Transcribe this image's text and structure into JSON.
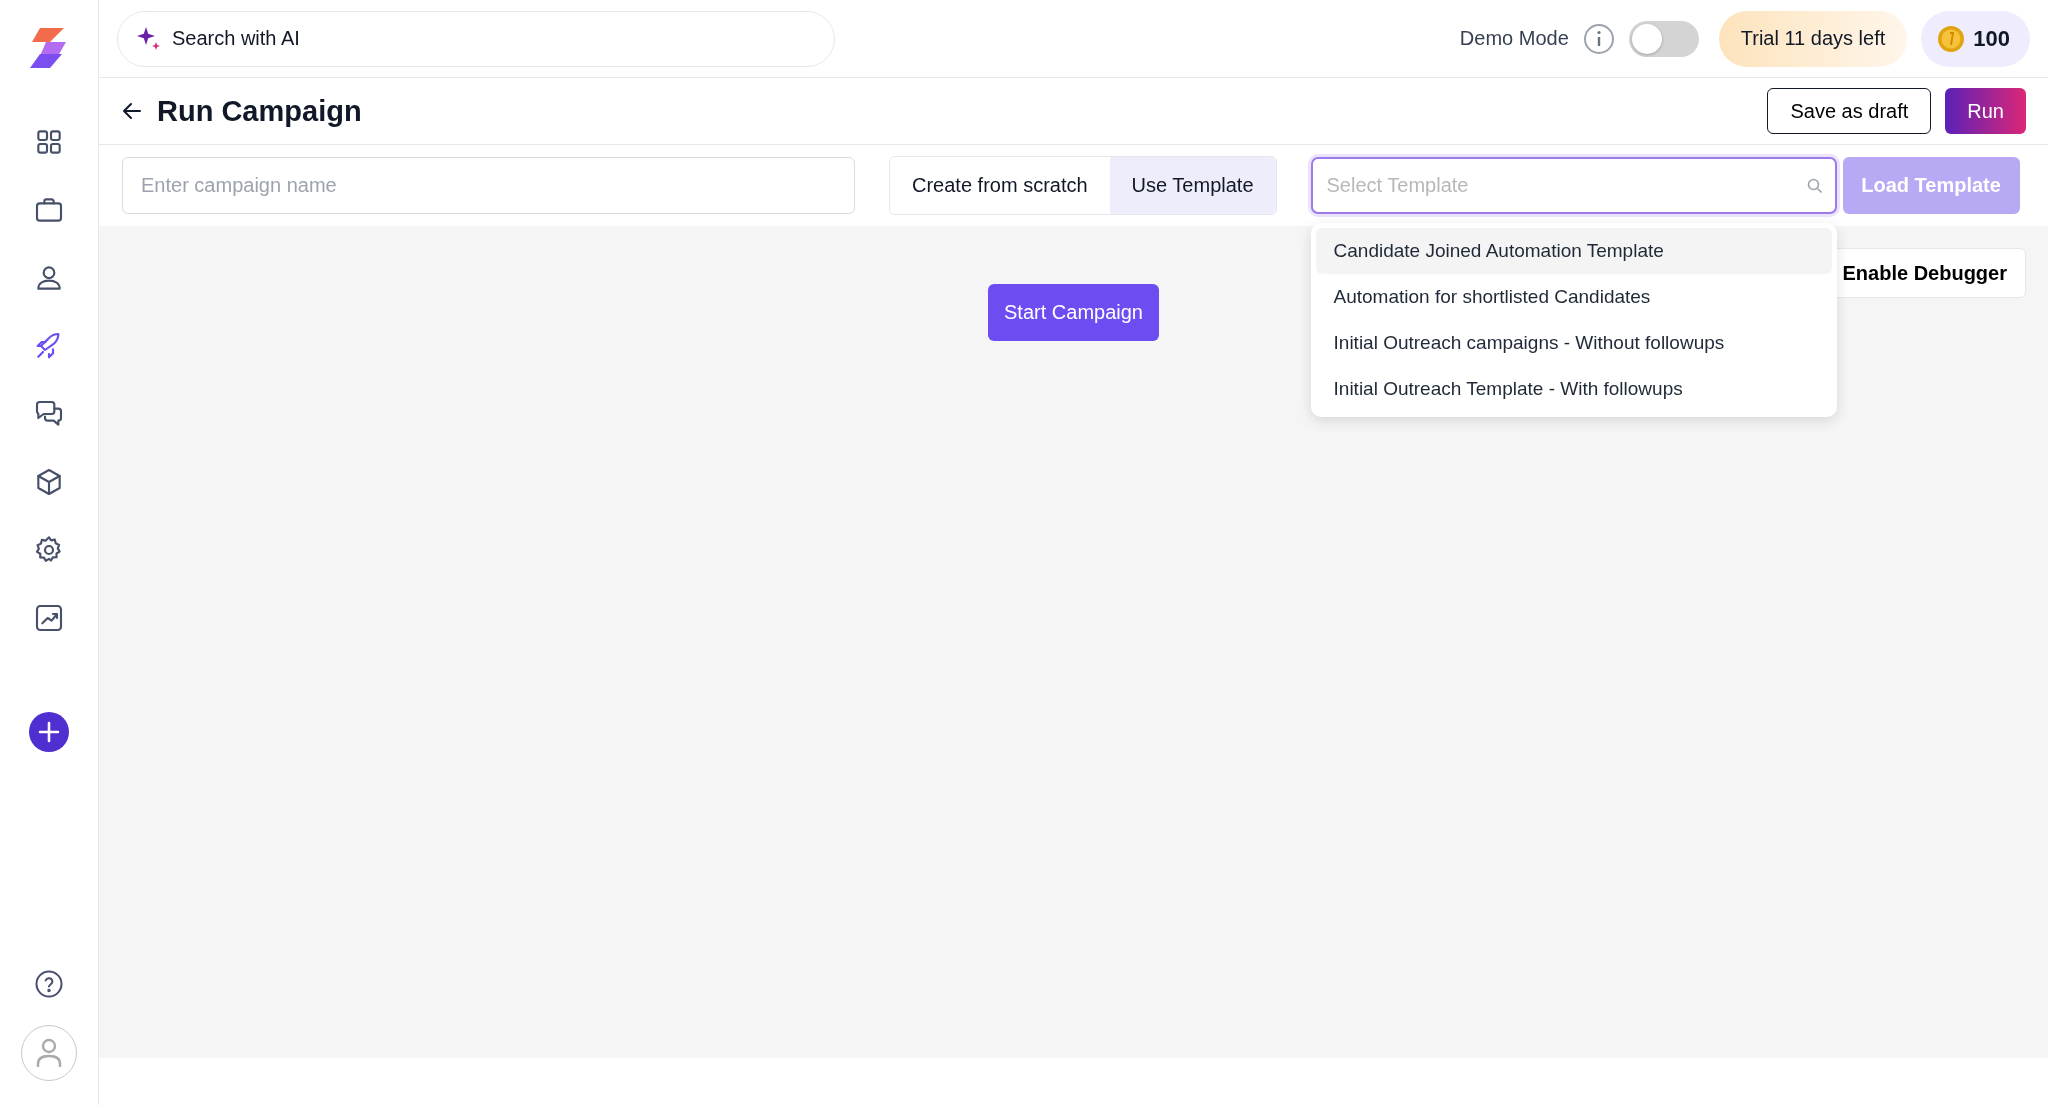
{
  "sidebar": {
    "items": [
      {
        "kind": "grid",
        "selected": false
      },
      {
        "kind": "briefcase",
        "selected": false
      },
      {
        "kind": "person",
        "selected": false
      },
      {
        "kind": "rocket",
        "selected": true
      },
      {
        "kind": "chat",
        "selected": false
      },
      {
        "kind": "cube",
        "selected": false
      },
      {
        "kind": "gear",
        "selected": false
      },
      {
        "kind": "chart",
        "selected": false
      }
    ],
    "bottom_items": [
      {
        "kind": "help"
      },
      {
        "kind": "avatar"
      }
    ]
  },
  "topbar": {
    "search": {
      "placeholder": "Search with AI"
    },
    "demo_mode": {
      "label": "Demo Mode",
      "on": false
    },
    "trial_badge": "Trial 11 days left",
    "credits": "100"
  },
  "header": {
    "title": "Run Campaign",
    "buttons": [
      "Save as draft",
      "Run"
    ]
  },
  "controls": {
    "campaign_name": {
      "placeholder": "Enter campaign name"
    },
    "mode_tabs": [
      {
        "label": "Create from scratch",
        "selected": false
      },
      {
        "label": "Use Template",
        "selected": true
      }
    ],
    "template_select": {
      "placeholder": "Select Template",
      "expanded": true,
      "options": [
        {
          "label": "Candidate Joined Automation Template",
          "selected": true
        },
        {
          "label": "Automation for shortlisted Candidates",
          "selected": false
        },
        {
          "label": "Initial Outreach campaigns - Without followups",
          "selected": false
        },
        {
          "label": "Initial Outreach Template - With followups",
          "selected": false
        }
      ]
    },
    "load_button": {
      "label": "Load Template",
      "disabled": true
    }
  },
  "canvas": {
    "start_button": "Start Campaign",
    "debugger_button": "Enable Debugger"
  }
}
